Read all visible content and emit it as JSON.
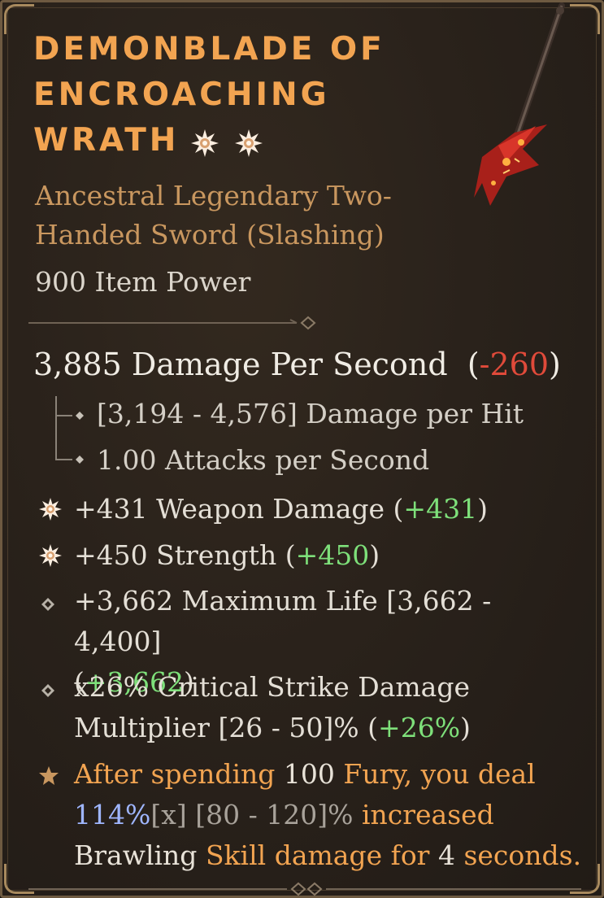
{
  "item": {
    "title_lines": [
      "DEMONBLADE OF",
      "ENCROACHING",
      "WRATH"
    ],
    "type_lines": [
      "Ancestral Legendary Two-",
      "Handed Sword (Slashing)"
    ],
    "item_power": "900 Item Power",
    "icon": "two-handed-sword-icon"
  },
  "dps": {
    "value": "3,885 Damage Per Second",
    "open": "(",
    "delta": "-260",
    "close": ")",
    "damage_per_hit": "[3,194 - 4,576] Damage per Hit",
    "attacks_per_second": "1.00 Attacks per Second"
  },
  "affixes": [
    {
      "icon": "greater-affix-icon",
      "text": "+431 Weapon Damage",
      "open": "(",
      "delta": "+431",
      "close": ")"
    },
    {
      "icon": "greater-affix-icon",
      "text": "+450 Strength",
      "open": "(",
      "delta": "+450",
      "close": ")"
    },
    {
      "icon": "affix-diamond-icon",
      "line1": "+3,662 Maximum Life [3,662 - 4,400]",
      "open": "(",
      "delta": "+3,662",
      "close": ")"
    },
    {
      "icon": "affix-diamond-icon",
      "line1": "x26% Critical Strike Damage",
      "line2_text": "Multiplier [26 - 50]%",
      "open": "(",
      "delta": "+26%",
      "close": ")"
    }
  ],
  "legendary": {
    "icon": "legendary-aspect-star-icon",
    "seg1": "After spending",
    "seg2": "100",
    "seg3": "Fury, you deal",
    "seg4": "114%",
    "seg5": "[x]",
    "seg6": "[80 - 120]%",
    "seg7": "increased",
    "seg8": "Brawling",
    "seg9": "Skill damage for",
    "seg10": "4",
    "seg11": "seconds."
  },
  "colors": {
    "title": "#f2a451",
    "negative": "#e04a3a",
    "positive": "#7ee07a",
    "highlight_blue": "#9fb6ff"
  }
}
